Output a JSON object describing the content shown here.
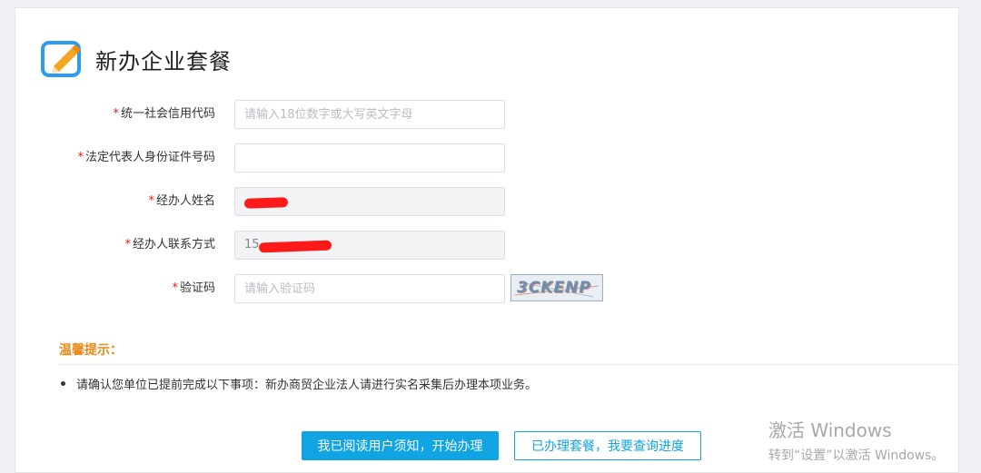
{
  "header": {
    "title": "新办企业套餐"
  },
  "form": {
    "credit_code": {
      "label": "统一社会信用代码",
      "value": "",
      "placeholder": "请输入18位数字或大写英文字母"
    },
    "legal_rep_id": {
      "label": "法定代表人身份证件号码",
      "value": "",
      "placeholder": ""
    },
    "operator_name": {
      "label": "经办人姓名",
      "value": ""
    },
    "operator_contact": {
      "label": "经办人联系方式",
      "value": "15"
    },
    "captcha": {
      "label": "验证码",
      "value": "",
      "placeholder": "请输入验证码",
      "image_text": "3CKENP"
    }
  },
  "tips": {
    "title": "温馨提示：",
    "items": [
      "请确认您单位已提前完成以下事项：新办商贸企业法人请进行实名采集后办理本项业务。"
    ]
  },
  "actions": {
    "start_label": "我已阅读用户须知，开始办理",
    "progress_label": "已办理套餐，我要查询进度"
  },
  "watermark": {
    "line1": "激活 Windows",
    "line2": "转到“设置”以激活 Windows。"
  },
  "colors": {
    "primary": "#10a4e3",
    "required": "#e02020",
    "tip_title": "#e8891a"
  }
}
